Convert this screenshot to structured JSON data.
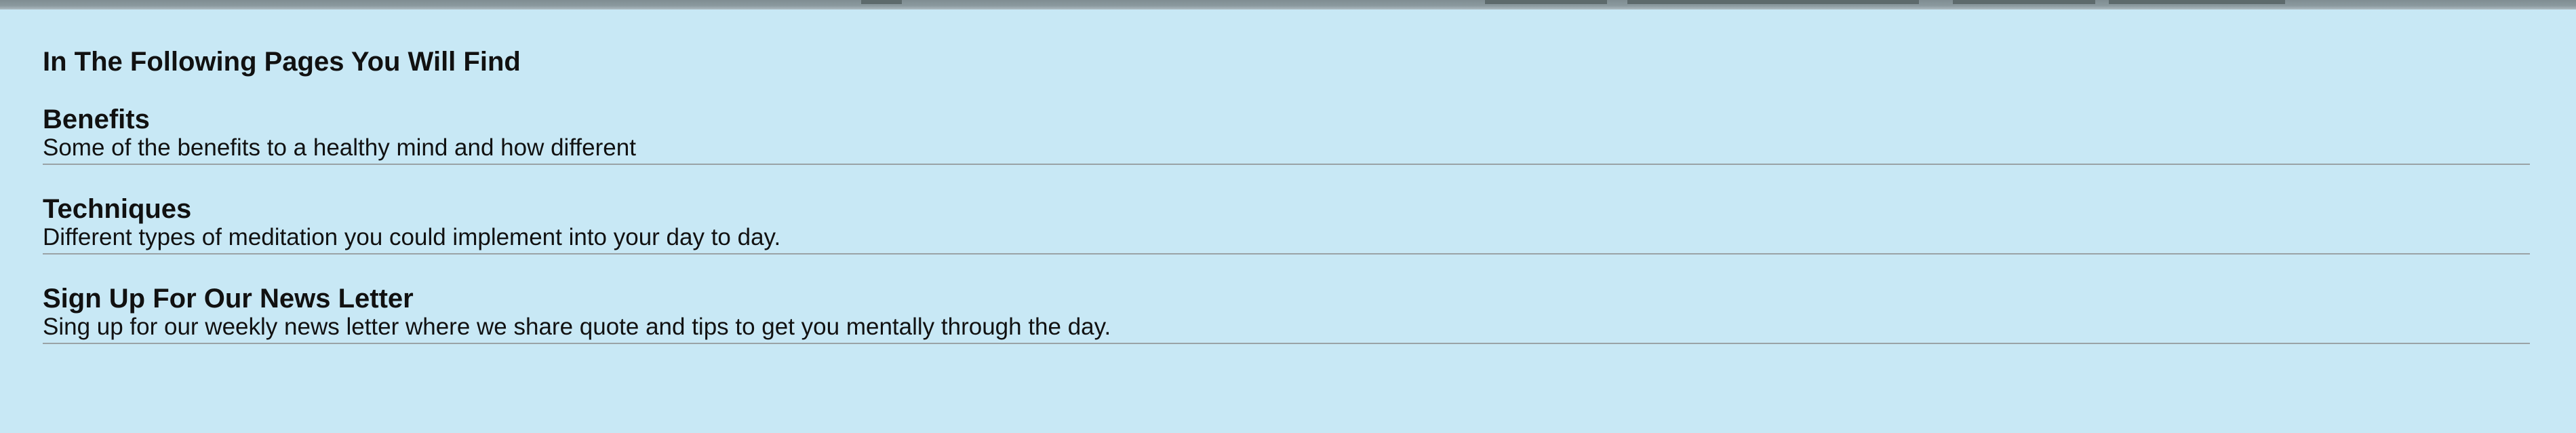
{
  "page_title": "In The Following Pages You Will Find",
  "sections": [
    {
      "heading": "Benefits",
      "description": "Some of the benefits to a healthy mind and how different"
    },
    {
      "heading": "Techniques",
      "description": "Different types of meditation you could implement into your day to day."
    },
    {
      "heading": "Sign Up For Our News Letter",
      "description": "Sing up for our weekly news letter where we share quote and tips to get you mentally through the day."
    }
  ],
  "colors": {
    "background": "#c8e8f5",
    "text": "#111111",
    "divider": "#9aa3a6"
  }
}
